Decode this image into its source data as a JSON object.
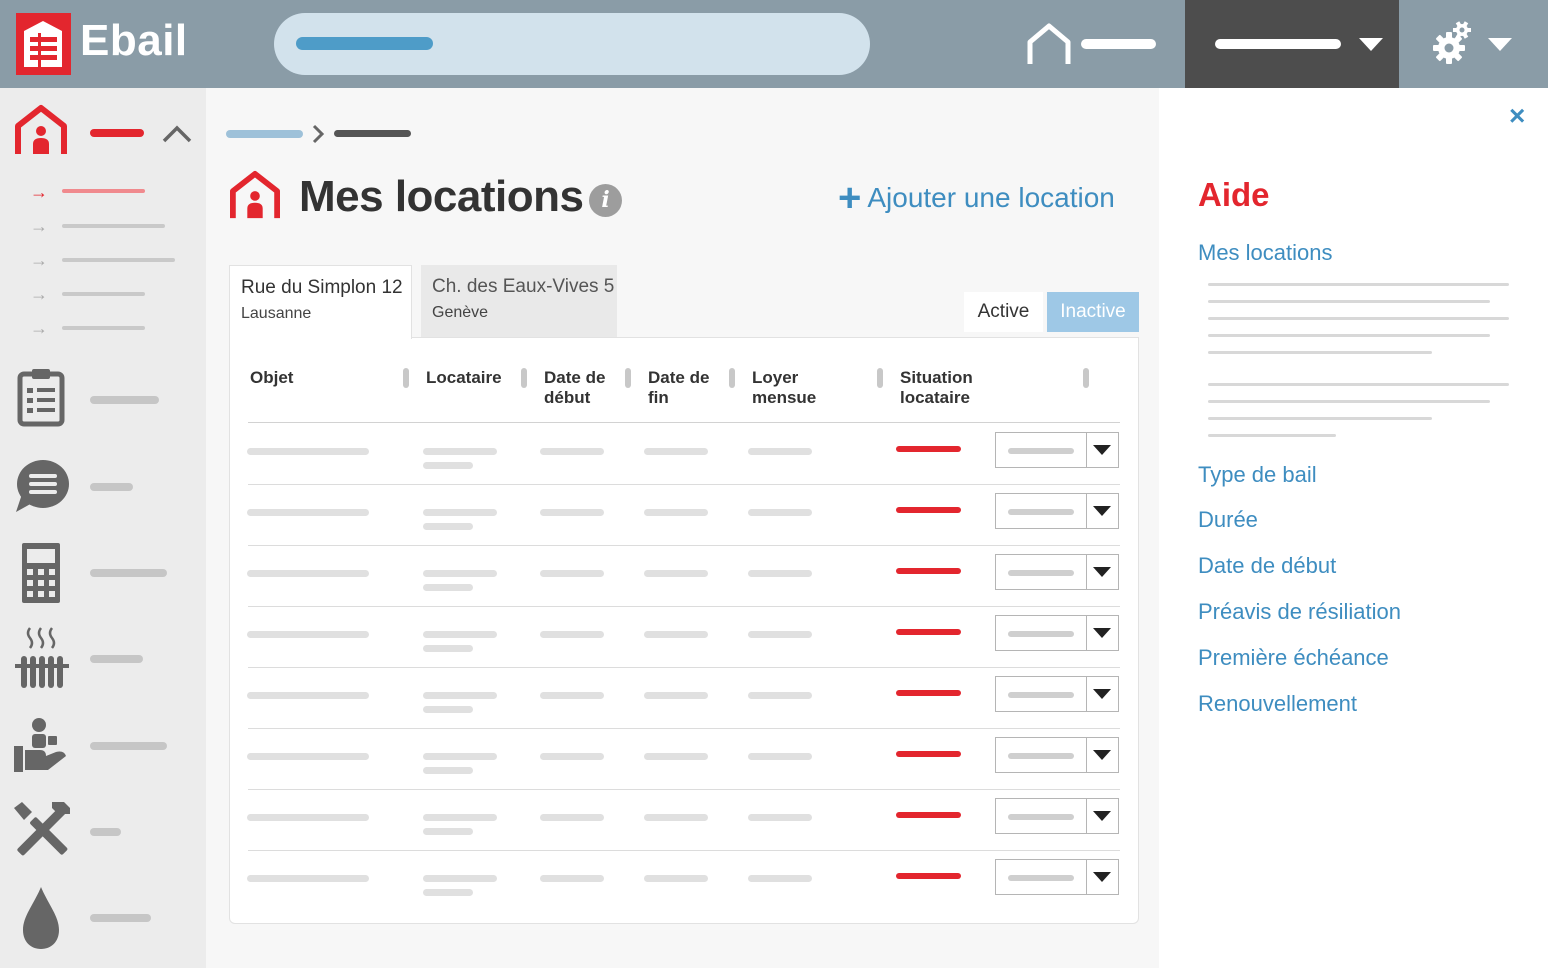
{
  "app": {
    "name": "Ebail"
  },
  "colors": {
    "brand_red": "#e3262e",
    "topbar": "#8a9ca7",
    "link_blue": "#3e8dc0",
    "user_menu_bg": "#4d4d4d"
  },
  "icons": {
    "logo": "ebail-logo-icon",
    "home": "home-icon",
    "settings": "gear-icon",
    "nav": [
      "rental-home-icon",
      "clipboard-icon",
      "chat-icon",
      "calculator-icon",
      "heating-icon",
      "handover-icon",
      "tools-icon",
      "water-drop-icon"
    ]
  },
  "page": {
    "title": "Mes locations",
    "info_glyph": "i",
    "add_button_plus": "+",
    "add_button_label": "Ajouter une location"
  },
  "tabs": [
    {
      "title": "Rue du Simplon 12",
      "subtitle": "Lausanne"
    },
    {
      "title": "Ch. des Eaux-Vives 5",
      "subtitle": "Genève"
    }
  ],
  "status_toggle": {
    "active": "Active",
    "inactive": "Inactive",
    "selected": "Active"
  },
  "table": {
    "columns": [
      {
        "label": "Objet"
      },
      {
        "label": "Locataire"
      },
      {
        "label": "Date de début"
      },
      {
        "label": "Date de fin"
      },
      {
        "label": "Loyer mensue"
      },
      {
        "label": "Situation locataire"
      }
    ],
    "row_count": 8
  },
  "help": {
    "close_glyph": "×",
    "title": "Aide",
    "links": [
      "Mes locations",
      "Type de bail",
      "Durée",
      "Date de début",
      "Préavis de résiliation",
      "Première échéance",
      "Renouvellement"
    ]
  }
}
